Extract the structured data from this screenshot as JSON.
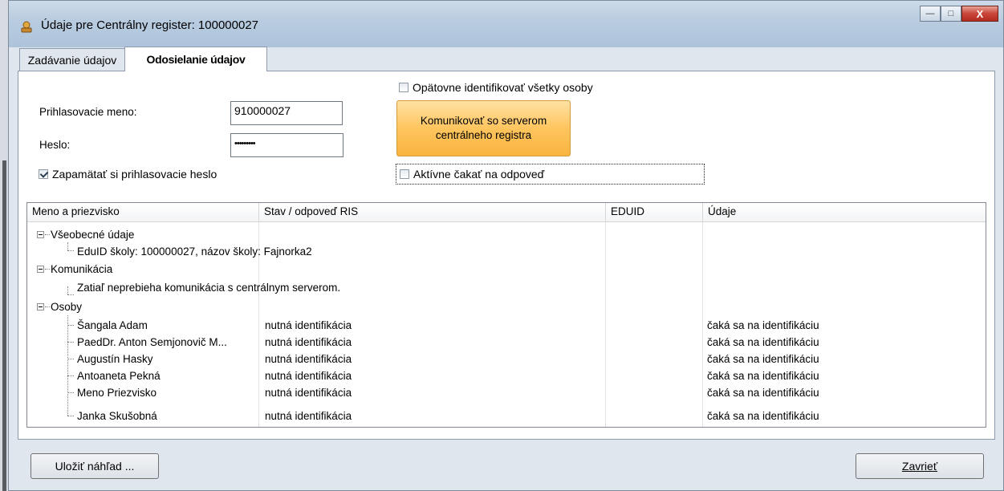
{
  "window": {
    "title": "Údaje pre Centrálny register: 100000027",
    "minimize_glyph": "—",
    "maximize_glyph": "□",
    "close_glyph": "X"
  },
  "tabs": [
    {
      "label": "Zadávanie údajov",
      "active": false
    },
    {
      "label": "Odosielanie údajov",
      "active": true
    }
  ],
  "login": {
    "username_label": "Prihlasovacie meno:",
    "username_value": "910000027",
    "password_label": "Heslo:",
    "password_value": "•••••••••",
    "remember_label": "Zapamätať si prihlasovacie heslo",
    "remember_checked": true
  },
  "options": {
    "reidentify_label": "Opätovne identifikovať všetky osoby",
    "reidentify_checked": false,
    "wait_label": "Aktívne čakať na odpoveď",
    "wait_checked": false
  },
  "communicate_button": {
    "line1": "Komunikovať so serverom",
    "line2": "centrálneho registra"
  },
  "list": {
    "columns": [
      "Meno a priezvisko",
      "Stav / odpoveď RIS",
      "EDUID",
      "Údaje"
    ],
    "groups": [
      {
        "label": "Všeobecné údaje",
        "children": [
          {
            "name": "EduID školy: 100000027, názov školy: Fajnorka2",
            "status": "",
            "eduid": "",
            "data": ""
          }
        ]
      },
      {
        "label": "Komunikácia",
        "children": [
          {
            "name": "Zatiaľ neprebieha komunikácia s centrálnym serverom.",
            "status": "",
            "eduid": "",
            "data": ""
          }
        ]
      },
      {
        "label": "Osoby",
        "children": [
          {
            "name": "Šangala Adam",
            "status": "nutná identifikácia",
            "eduid": "",
            "data": "čaká sa na identifikáciu"
          },
          {
            "name": "PaedDr. Anton Semjonovič M...",
            "status": "nutná identifikácia",
            "eduid": "",
            "data": "čaká sa na identifikáciu"
          },
          {
            "name": "Augustín Hasky",
            "status": "nutná identifikácia",
            "eduid": "",
            "data": "čaká sa na identifikáciu"
          },
          {
            "name": "Antoaneta Pekná",
            "status": "nutná identifikácia",
            "eduid": "",
            "data": "čaká sa na identifikáciu"
          },
          {
            "name": "Meno Priezvisko",
            "status": "nutná identifikácia",
            "eduid": "",
            "data": "čaká sa na identifikáciu"
          },
          {
            "name": "Janka Skušobná",
            "status": "nutná identifikácia",
            "eduid": "",
            "data": "čaká sa na identifikáciu"
          }
        ]
      }
    ]
  },
  "footer": {
    "save_preview_label": "Uložiť náhľad ...",
    "close_label": "Zavrieť"
  }
}
